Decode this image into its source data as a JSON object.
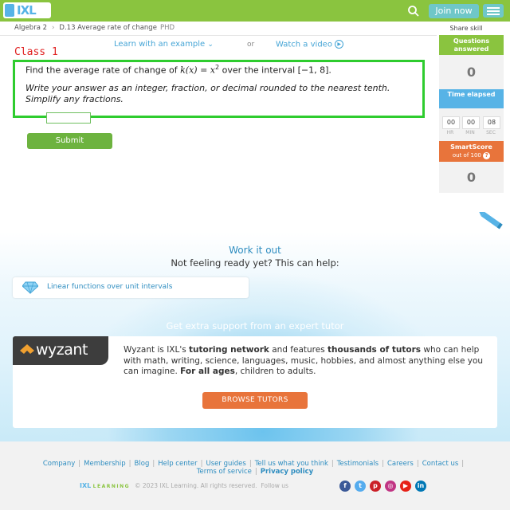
{
  "header": {
    "logo_text": "IXL",
    "join_label": "Join now"
  },
  "breadcrumb": {
    "subject": "Algebra 2",
    "skill": "D.13 Average rate of change",
    "code": "PHD",
    "share_label": "Share skill"
  },
  "help_links": {
    "learn": "Learn with an example",
    "or": "or",
    "watch": "Watch a video"
  },
  "annotation": {
    "label": "Class 1",
    "color": "#2ecc2e"
  },
  "question": {
    "prompt_before": "Find the average rate of change of ",
    "function": "k(x) = x",
    "exponent": "2",
    "prompt_after": " over the interval [−1, 8].",
    "instructions": "Write your answer as an integer, fraction, or decimal rounded to the nearest tenth. Simplify any fractions.",
    "answer_value": "",
    "submit_label": "Submit"
  },
  "sidebar": {
    "questions_answered_label": "Questions answered",
    "questions_answered_value": "0",
    "time_elapsed_label": "Time elapsed",
    "time": {
      "hr": "00",
      "min": "00",
      "sec": "08"
    },
    "time_units": {
      "hr": "HR",
      "min": "MIN",
      "sec": "SEC"
    },
    "smartscore_label": "SmartScore",
    "smartscore_sub": "out of 100",
    "smartscore_value": "0"
  },
  "work_it_out": {
    "title": "Work it out",
    "subtitle": "Not feeling ready yet? This can help:",
    "skill_link": "Linear functions over unit intervals"
  },
  "tutor": {
    "heading": "Get extra support from an expert tutor",
    "brand": "wyzant",
    "p1": "Wyzant is IXL's ",
    "b1": "tutoring network",
    "p2": " and features ",
    "b2": "thousands of tutors",
    "p3": " who can help with math, writing, science, languages, music, hobbies, and almost anything else you can imagine. ",
    "b3": "For all ages",
    "p4": ", children to adults.",
    "button": "BROWSE TUTORS"
  },
  "footer": {
    "links": [
      "Company",
      "Membership",
      "Blog",
      "Help center",
      "User guides",
      "Tell us what you think",
      "Testimonials",
      "Careers",
      "Contact us"
    ],
    "terms": "Terms of service",
    "privacy": "Privacy policy",
    "brand": "IXL",
    "brand_sub": "LEARNING",
    "copyright": "© 2023 IXL Learning. All rights reserved.",
    "follow": "Follow us",
    "social_colors": [
      "#3b5998",
      "#55acee",
      "#cb2027",
      "#c13584",
      "#e62117",
      "#0077b5"
    ]
  }
}
